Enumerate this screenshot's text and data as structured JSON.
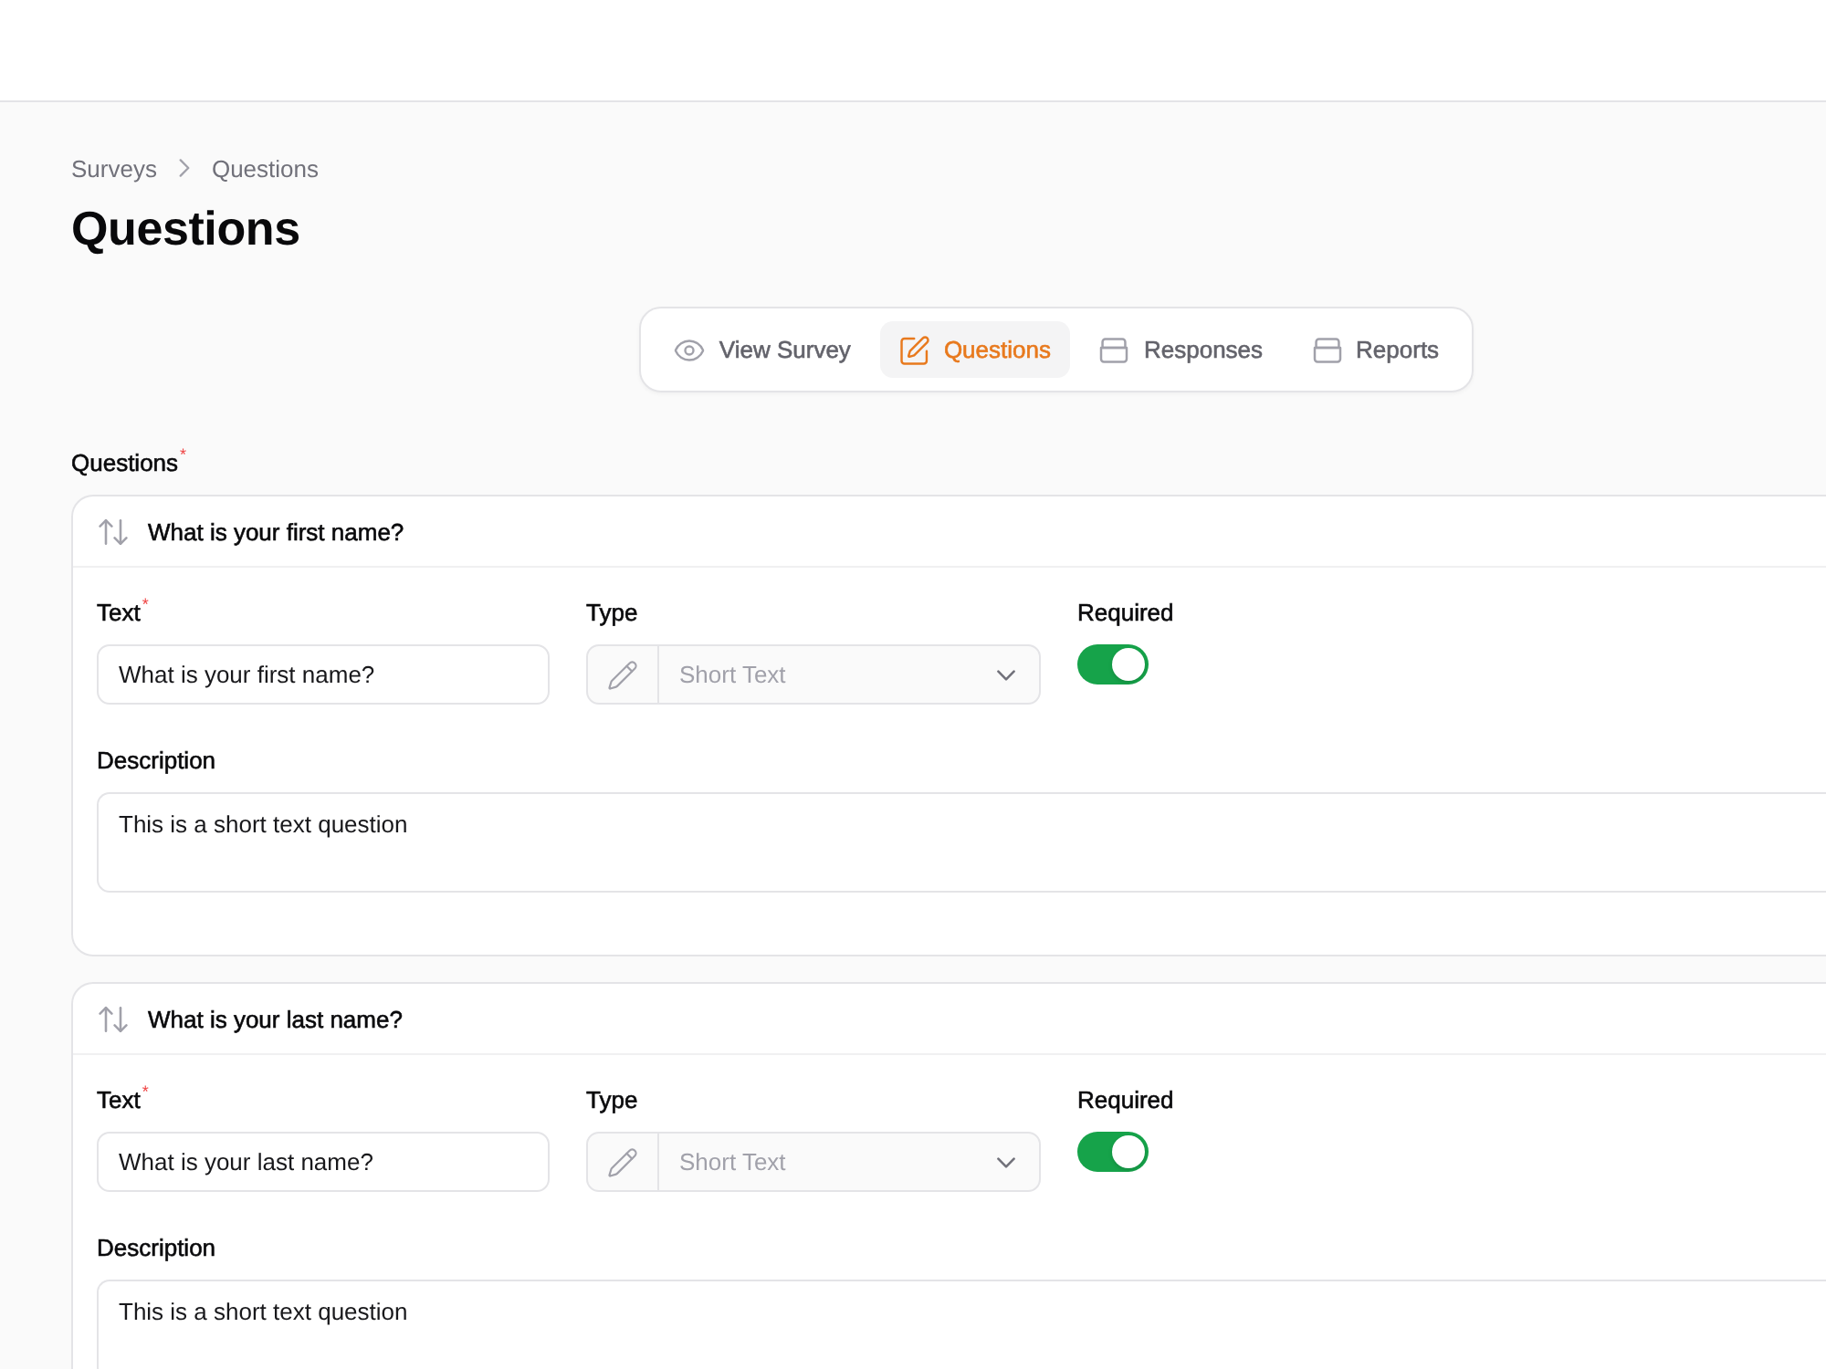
{
  "breadcrumb": [
    {
      "label": "Surveys"
    },
    {
      "label": "Questions"
    }
  ],
  "page_title": "Questions",
  "tabs": [
    {
      "label": "View Survey",
      "kind": "view",
      "selected": false
    },
    {
      "label": "Questions",
      "kind": "edit",
      "selected": true
    },
    {
      "label": "Responses",
      "kind": "records",
      "selected": false
    },
    {
      "label": "Reports",
      "kind": "records",
      "selected": false
    }
  ],
  "questions_section": {
    "label": "Questions",
    "required_mark": "*"
  },
  "questions": [
    {
      "title": "What is your first name?",
      "text_field": {
        "label": "Text",
        "required_mark": "*",
        "value": "What is your first name?"
      },
      "type_field": {
        "label": "Type",
        "value": "Short Text",
        "disabled": true
      },
      "required_field": {
        "label": "Required",
        "on": true
      },
      "description_field": {
        "label": "Description",
        "value": "This is a short text question"
      }
    },
    {
      "title": "What is your last name?",
      "text_field": {
        "label": "Text",
        "required_mark": "*",
        "value": "What is your last name?"
      },
      "type_field": {
        "label": "Type",
        "value": "Short Text",
        "disabled": true
      },
      "required_field": {
        "label": "Required",
        "on": true
      },
      "description_field": {
        "label": "Description",
        "value": "This is a short text question"
      }
    }
  ]
}
